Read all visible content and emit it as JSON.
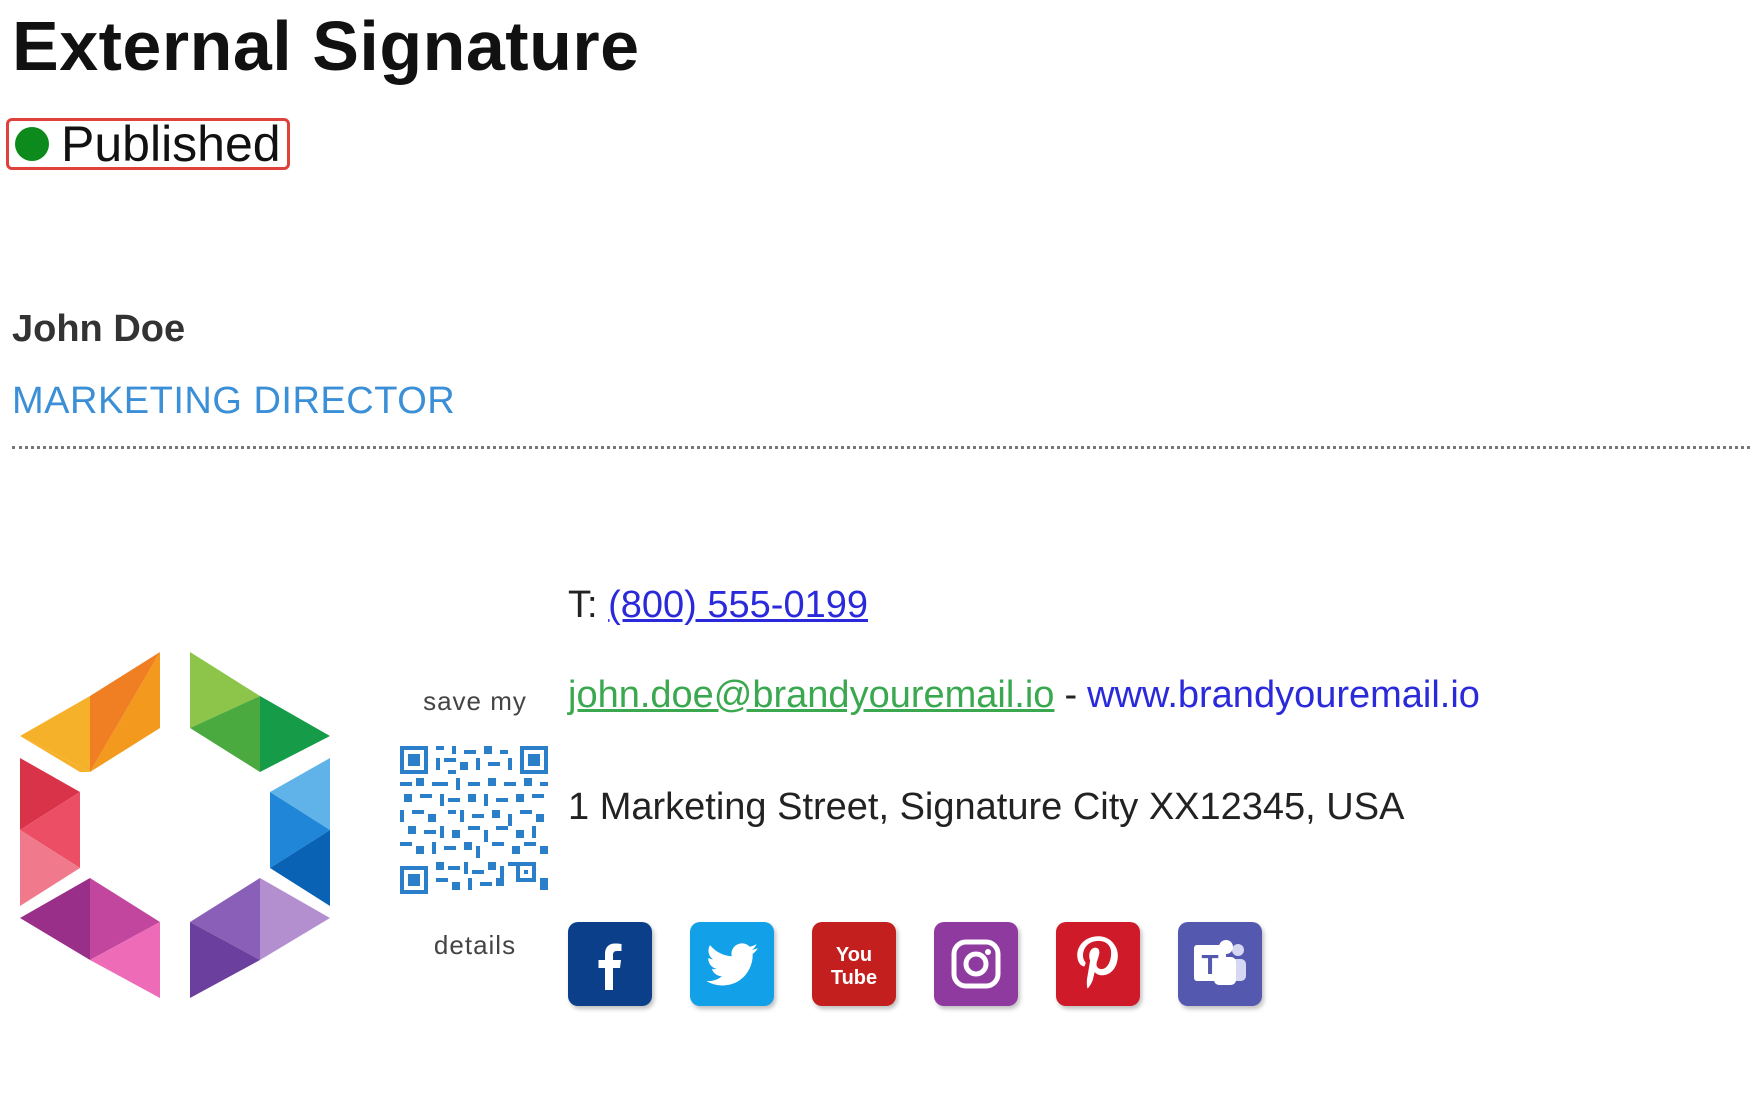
{
  "header": {
    "title": "External Signature",
    "status": {
      "label": "Published",
      "color": "#0c8a1c",
      "highlight_color": "#e0413b"
    }
  },
  "signature": {
    "name": "John Doe",
    "job_title": "MARKETING DIRECTOR",
    "qr": {
      "caption_top": "save my",
      "caption_bottom": "details"
    },
    "contact": {
      "phone_prefix": "T:",
      "phone": "(800) 555-0199",
      "email": "john.doe@brandyouremail.io",
      "separator": "-",
      "website": "www.brandyouremail.io",
      "address": "1 Marketing Street, Signature City XX12345, USA"
    },
    "social": [
      {
        "name": "facebook-icon",
        "color": "#0b3f8a"
      },
      {
        "name": "twitter-icon",
        "color": "#12a0e8"
      },
      {
        "name": "youtube-icon",
        "color": "#c41f1f",
        "text_line1": "You",
        "text_line2": "Tube"
      },
      {
        "name": "instagram-icon",
        "color": "#8e3a9e"
      },
      {
        "name": "pinterest-icon",
        "color": "#cf1a2a"
      },
      {
        "name": "teams-icon",
        "color": "#5558af",
        "text": "T"
      }
    ],
    "colors": {
      "title": "#3b8fd6",
      "email": "#3aa84e",
      "links": "#2a2adb"
    }
  }
}
